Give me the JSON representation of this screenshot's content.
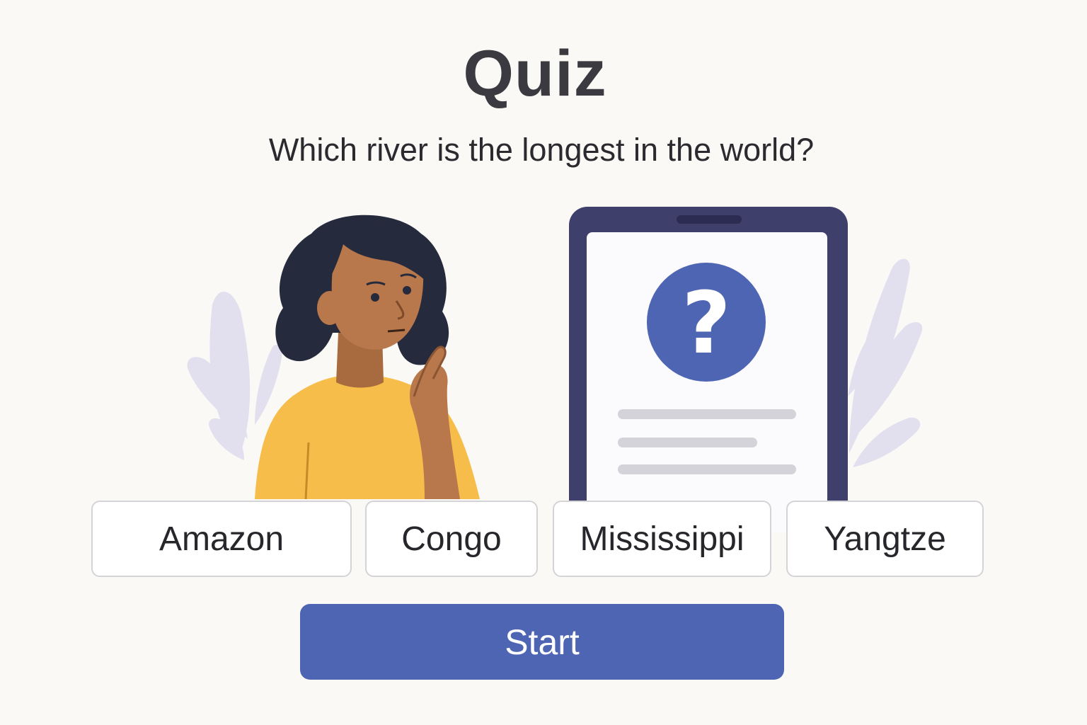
{
  "quiz": {
    "title": "Quiz",
    "question": "Which river is the longest in the world?"
  },
  "answers": [
    {
      "label": "Amazon"
    },
    {
      "label": "Congo"
    },
    {
      "label": "Mississippi"
    },
    {
      "label": "Yangtze"
    }
  ],
  "start_button": {
    "label": "Start"
  },
  "illustration": {
    "person": "thinking-person-illustration",
    "device": "tablet-illustration",
    "device_icon": "question-mark-icon",
    "leaves": "leaf-decoration"
  },
  "colors": {
    "background": "#fbf9f5",
    "accent": "#4e65b4",
    "tablet_frame": "#3f3f6b",
    "shirt": "#f7bd4a",
    "skin": "#b8784b",
    "hair": "#262a3d",
    "leaf": "#e1dfee"
  }
}
